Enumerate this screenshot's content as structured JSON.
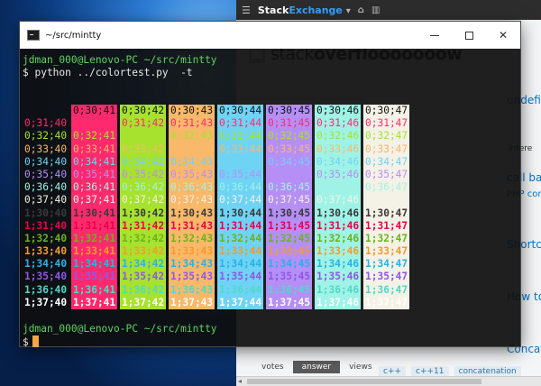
{
  "browser": {
    "site_name_a": "Stack",
    "site_name_b": "Exchange",
    "logo_light": "stack",
    "logo_bold": "overflooooooow",
    "side_label": "intere",
    "questions": [
      "undefined variable deno top",
      "call back from powershel",
      "PHP console",
      "Shortcut with TabWidget in",
      "How to check Keepalive time and",
      "Concatenate text and variables C"
    ],
    "tabs": [
      "votes",
      "answer",
      "views"
    ],
    "tags": [
      "c++",
      "c++11",
      "concatenation"
    ]
  },
  "terminal": {
    "title": "~/src/mintty",
    "prompt": "jdman_000@Lenovo-PC ~/src/mintty",
    "command": "$ python ../colortest.py  -t",
    "prompt2": "jdman_000@Lenovo-PC ~/src/mintty",
    "dollar": "$"
  },
  "colortable": {
    "header": [
      "0;30;41",
      "0;30;42",
      "0;30;43",
      "0;30;44",
      "0;30;45",
      "0;30;46",
      "0;30;47"
    ],
    "rows": [
      [
        "0;31;40",
        "0;31;41",
        "0;31;42",
        "0;31;43",
        "0;31;44",
        "0;31;45",
        "0;31;46",
        "0;31;47"
      ],
      [
        "0;32;40",
        "0;32;41",
        "0;32;42",
        "0;32;43",
        "0;32;44",
        "0;32;45",
        "0;32;46",
        "0;32;47"
      ],
      [
        "0;33;40",
        "0;33;41",
        "0;33;42",
        "0;33;43",
        "0;33;44",
        "0;33;45",
        "0;33;46",
        "0;33;47"
      ],
      [
        "0;34;40",
        "0;34;41",
        "0;34;42",
        "0;34;43",
        "0;34;44",
        "0;34;45",
        "0;34;46",
        "0;34;47"
      ],
      [
        "0;35;40",
        "0;35;41",
        "0;35;42",
        "0;35;43",
        "0;35;44",
        "0;35;45",
        "0;35;46",
        "0;35;47"
      ],
      [
        "0;36;40",
        "0;36;41",
        "0;36;42",
        "0;36;43",
        "0;36;44",
        "0;36;45",
        "0;36;46",
        "0;36;47"
      ],
      [
        "0;37;40",
        "0;37;41",
        "0;37;42",
        "0;37;43",
        "0;37;44",
        "0;37;45",
        "0;37;46",
        "0;37;47"
      ],
      [
        "1;30;40",
        "1;30;41",
        "1;30;42",
        "1;30;43",
        "1;30;44",
        "1;30;45",
        "1;30;46",
        "1;30;47"
      ],
      [
        "1;31;40",
        "1;31;41",
        "1;31;42",
        "1;31;43",
        "1;31;44",
        "1;31;45",
        "1;31;46",
        "1;31;47"
      ],
      [
        "1;32;40",
        "1;32;41",
        "1;32;42",
        "1;32;43",
        "1;32;44",
        "1;32;45",
        "1;32;46",
        "1;32;47"
      ],
      [
        "1;33;40",
        "1;33;41",
        "1;33;42",
        "1;33;43",
        "1;33;44",
        "1;33;45",
        "1;33;46",
        "1;33;47"
      ],
      [
        "1;34;40",
        "1;34;41",
        "1;34;42",
        "1;34;43",
        "1;34;44",
        "1;34;45",
        "1;34;46",
        "1;34;47"
      ],
      [
        "1;35;40",
        "1;35;41",
        "1;35;42",
        "1;35;43",
        "1;35;44",
        "1;35;45",
        "1;35;46",
        "1;35;47"
      ],
      [
        "1;36;40",
        "1;36;41",
        "1;36;42",
        "1;36;43",
        "1;36;44",
        "1;36;45",
        "1;36;46",
        "1;36;47"
      ],
      [
        "1;37;40",
        "1;37;41",
        "1;37;42",
        "1;37;43",
        "1;37;44",
        "1;37;45",
        "1;37;46",
        "1;37;47"
      ]
    ],
    "bg_colors": [
      "transparent",
      "#ff2a6d",
      "#a6e22e",
      "#f9b86a",
      "#6fd3f5",
      "#b58ff5",
      "#9ff3e6",
      "#f4f1e6"
    ],
    "fg_normal": {
      "30": "#1a1a1a",
      "31": "#ff2a6d",
      "32": "#a6e22e",
      "33": "#f9b86a",
      "34": "#6fd3f5",
      "35": "#b58ff5",
      "36": "#9ff3e6",
      "37": "#f4f1e6"
    },
    "fg_bold": {
      "30": "#3a3a3a",
      "31": "#e8004b",
      "32": "#6bb31a",
      "33": "#f59b2c",
      "34": "#27b3e8",
      "35": "#8f57e6",
      "36": "#4fd9c6",
      "37": "#ffffff"
    }
  }
}
